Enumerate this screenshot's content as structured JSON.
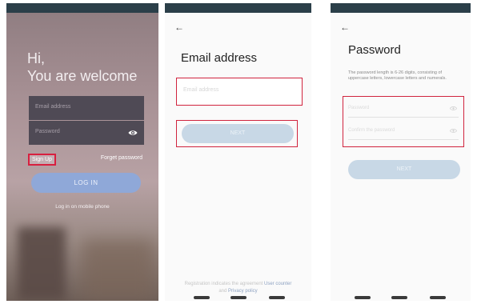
{
  "login": {
    "greeting_line1": "Hi,",
    "greeting_line2": "You are welcome",
    "email_placeholder": "Email address",
    "password_placeholder": "Password",
    "signup_label": "Sign Up",
    "forgot_label": "Forget password",
    "login_label": "LOG IN",
    "mobile_login_label": "Log in on mobile phone"
  },
  "email_screen": {
    "title": "Email address",
    "input_placeholder": "Email address",
    "next_label": "NEXT",
    "terms_prefix": "Registration indicates the agreement",
    "terms_link1": "User counter",
    "terms_and": "and",
    "terms_link2": "Privacy policy"
  },
  "password_screen": {
    "title": "Password",
    "description": "The password length is 6-26 digits, consisting of uppercase letters, lowercase letters and numerals.",
    "password_placeholder": "Password",
    "confirm_placeholder": "Confirm the password",
    "next_label": "NEXT"
  },
  "colors": {
    "highlight": "#d0243e",
    "button_login": "#8fa8d8",
    "button_next": "#c8d8e6"
  }
}
